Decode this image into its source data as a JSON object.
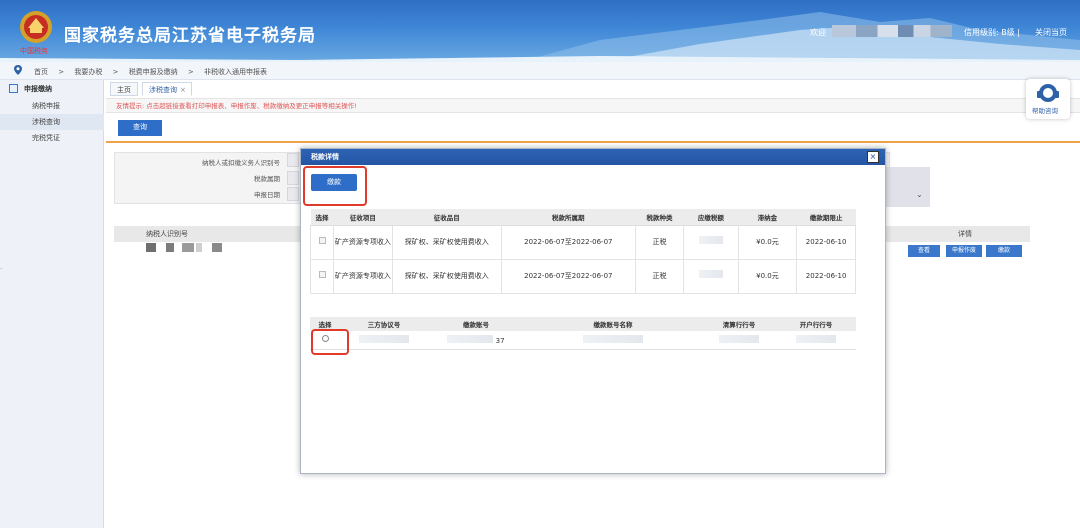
{
  "header": {
    "title": "国家税务总局江苏省电子税务局",
    "emblem_caption": "中国税务",
    "welcome": "欢迎",
    "level_info": "信用级别: B级 |",
    "close_page": "关闭当页"
  },
  "breadcrumb": [
    "首页",
    ">",
    "我要办税",
    ">",
    "税费申报及缴纳",
    ">",
    "非税收入通用申报表"
  ],
  "sidebar": {
    "heading": "申报缴纳",
    "items": [
      {
        "label": "纳税申报",
        "active": false
      },
      {
        "label": "涉税查询",
        "active": true
      },
      {
        "label": "完税凭证",
        "active": false
      }
    ]
  },
  "tabs": [
    {
      "label": "主页"
    },
    {
      "label": "涉税查询",
      "close": "×"
    }
  ],
  "notice": "友情提示: 点击超链接查看打印申报表、申报作废、税款缴纳及更正申报等相关操作!",
  "query_button": "查询",
  "form": {
    "labels": [
      "纳税人或扣缴义务人识别号",
      "税款属期",
      "申报日期"
    ]
  },
  "background_table": {
    "taxpayer_id_header": "纳税人识别号",
    "detail_header": "详情",
    "row_buttons": [
      "查看",
      "申报作废",
      "缴款"
    ]
  },
  "help": {
    "label": "帮助咨询"
  },
  "modal": {
    "title": "税款详情",
    "close_icon": "×",
    "pay_button": "缴款",
    "tax_table": {
      "headers": [
        "选择",
        "征收项目",
        "征收品目",
        "税款所属期",
        "税款种类",
        "应缴税额",
        "滞纳金",
        "缴款期限止"
      ],
      "rows": [
        {
          "item": "矿产资源专项收入",
          "sub_item": "探矿权、采矿权使用费收入",
          "period": "2022-06-07至2022-06-07",
          "type": "正税",
          "late_fee": "¥0.0元",
          "deadline": "2022-06-10"
        },
        {
          "item": "矿产资源专项收入",
          "sub_item": "探矿权、采矿权使用费收入",
          "period": "2022-06-07至2022-06-07",
          "type": "正税",
          "late_fee": "¥0.0元",
          "deadline": "2022-06-10"
        }
      ]
    },
    "account_table": {
      "headers": [
        "选择",
        "三方协议号",
        "缴款账号",
        "缴款账号名称",
        "清算行行号",
        "开户行行号"
      ],
      "rows": [
        {
          "account_suffix": "37"
        }
      ]
    }
  },
  "colors": {
    "header_blue": "#3f86d6",
    "button_blue": "#2e6ec9",
    "highlight_red": "#e03a2a",
    "notice_red": "#e05555",
    "accent_orange": "#f0a24a"
  }
}
